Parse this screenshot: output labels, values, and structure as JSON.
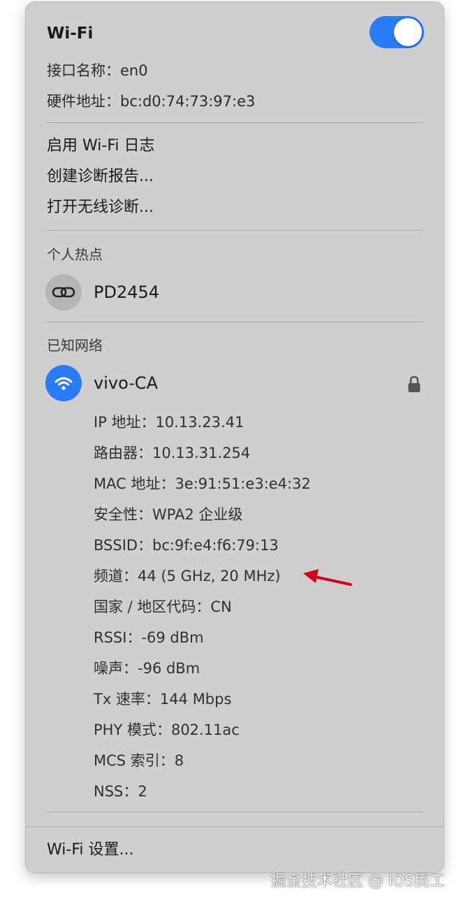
{
  "header": {
    "title": "Wi-Fi",
    "toggle_on": true,
    "accent_color": "#2a7bf6"
  },
  "interface": {
    "name_line": "接口名称：en0",
    "hardware_line": "硬件地址：bc:d0:74:73:97:e3"
  },
  "actions": {
    "enable_log": "启用 Wi-Fi 日志",
    "create_report": "创建诊断报告...",
    "open_diagnostics": "打开无线诊断..."
  },
  "hotspot": {
    "section_title": "个人热点",
    "device_name": "PD2454",
    "icon": "link-icon"
  },
  "known_networks": {
    "section_title": "已知网络",
    "network_name": "vivo-CA",
    "icon": "wifi-icon",
    "secured_icon": "lock-icon",
    "details": [
      "IP 地址：10.13.23.41",
      "路由器：10.13.31.254",
      "MAC 地址：3e:91:51:e3:e4:32",
      "安全性：WPA2 企业级",
      "BSSID：bc:9f:e4:f6:79:13",
      "频道：44 (5 GHz, 20 MHz)",
      "国家 / 地区代码：CN",
      "RSSI：-69 dBm",
      "噪声：-96 dBm",
      "Tx 速率：144 Mbps",
      "PHY 模式：802.11ac",
      "MCS 索引：8",
      "NSS：2"
    ],
    "highlighted_detail_index": 5,
    "annotation_color": "#d0021b"
  },
  "footer": {
    "settings": "Wi-Fi 设置..."
  },
  "watermark": "掘金技术社区 @ iOS民工"
}
